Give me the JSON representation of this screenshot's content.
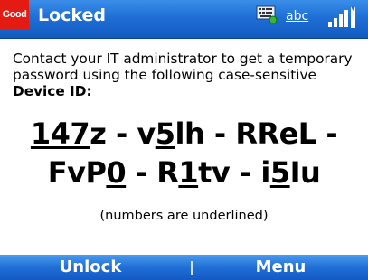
{
  "titlebar": {
    "logo_text": "Good",
    "title": "Locked",
    "status": {
      "input_method_label": "abc",
      "icons": [
        "keyboard-icon",
        "signal-strength-icon"
      ]
    }
  },
  "content": {
    "instructions": "Contact your IT administrator to get a temporary password using the following case-sensitive",
    "device_id_label": "Device ID:",
    "device_id": {
      "line1": [
        "147",
        "z - v",
        "5",
        "lh - RReL -"
      ],
      "line2": [
        "FvP",
        "0",
        " - R",
        "1",
        "tv - i",
        "5",
        "Iu"
      ]
    },
    "note": "(numbers are underlined)"
  },
  "softkeys": {
    "left": "Unlock",
    "right": "Menu"
  },
  "colors": {
    "bar_blue": "#1f6fd6",
    "logo_red": "#e31b12"
  }
}
